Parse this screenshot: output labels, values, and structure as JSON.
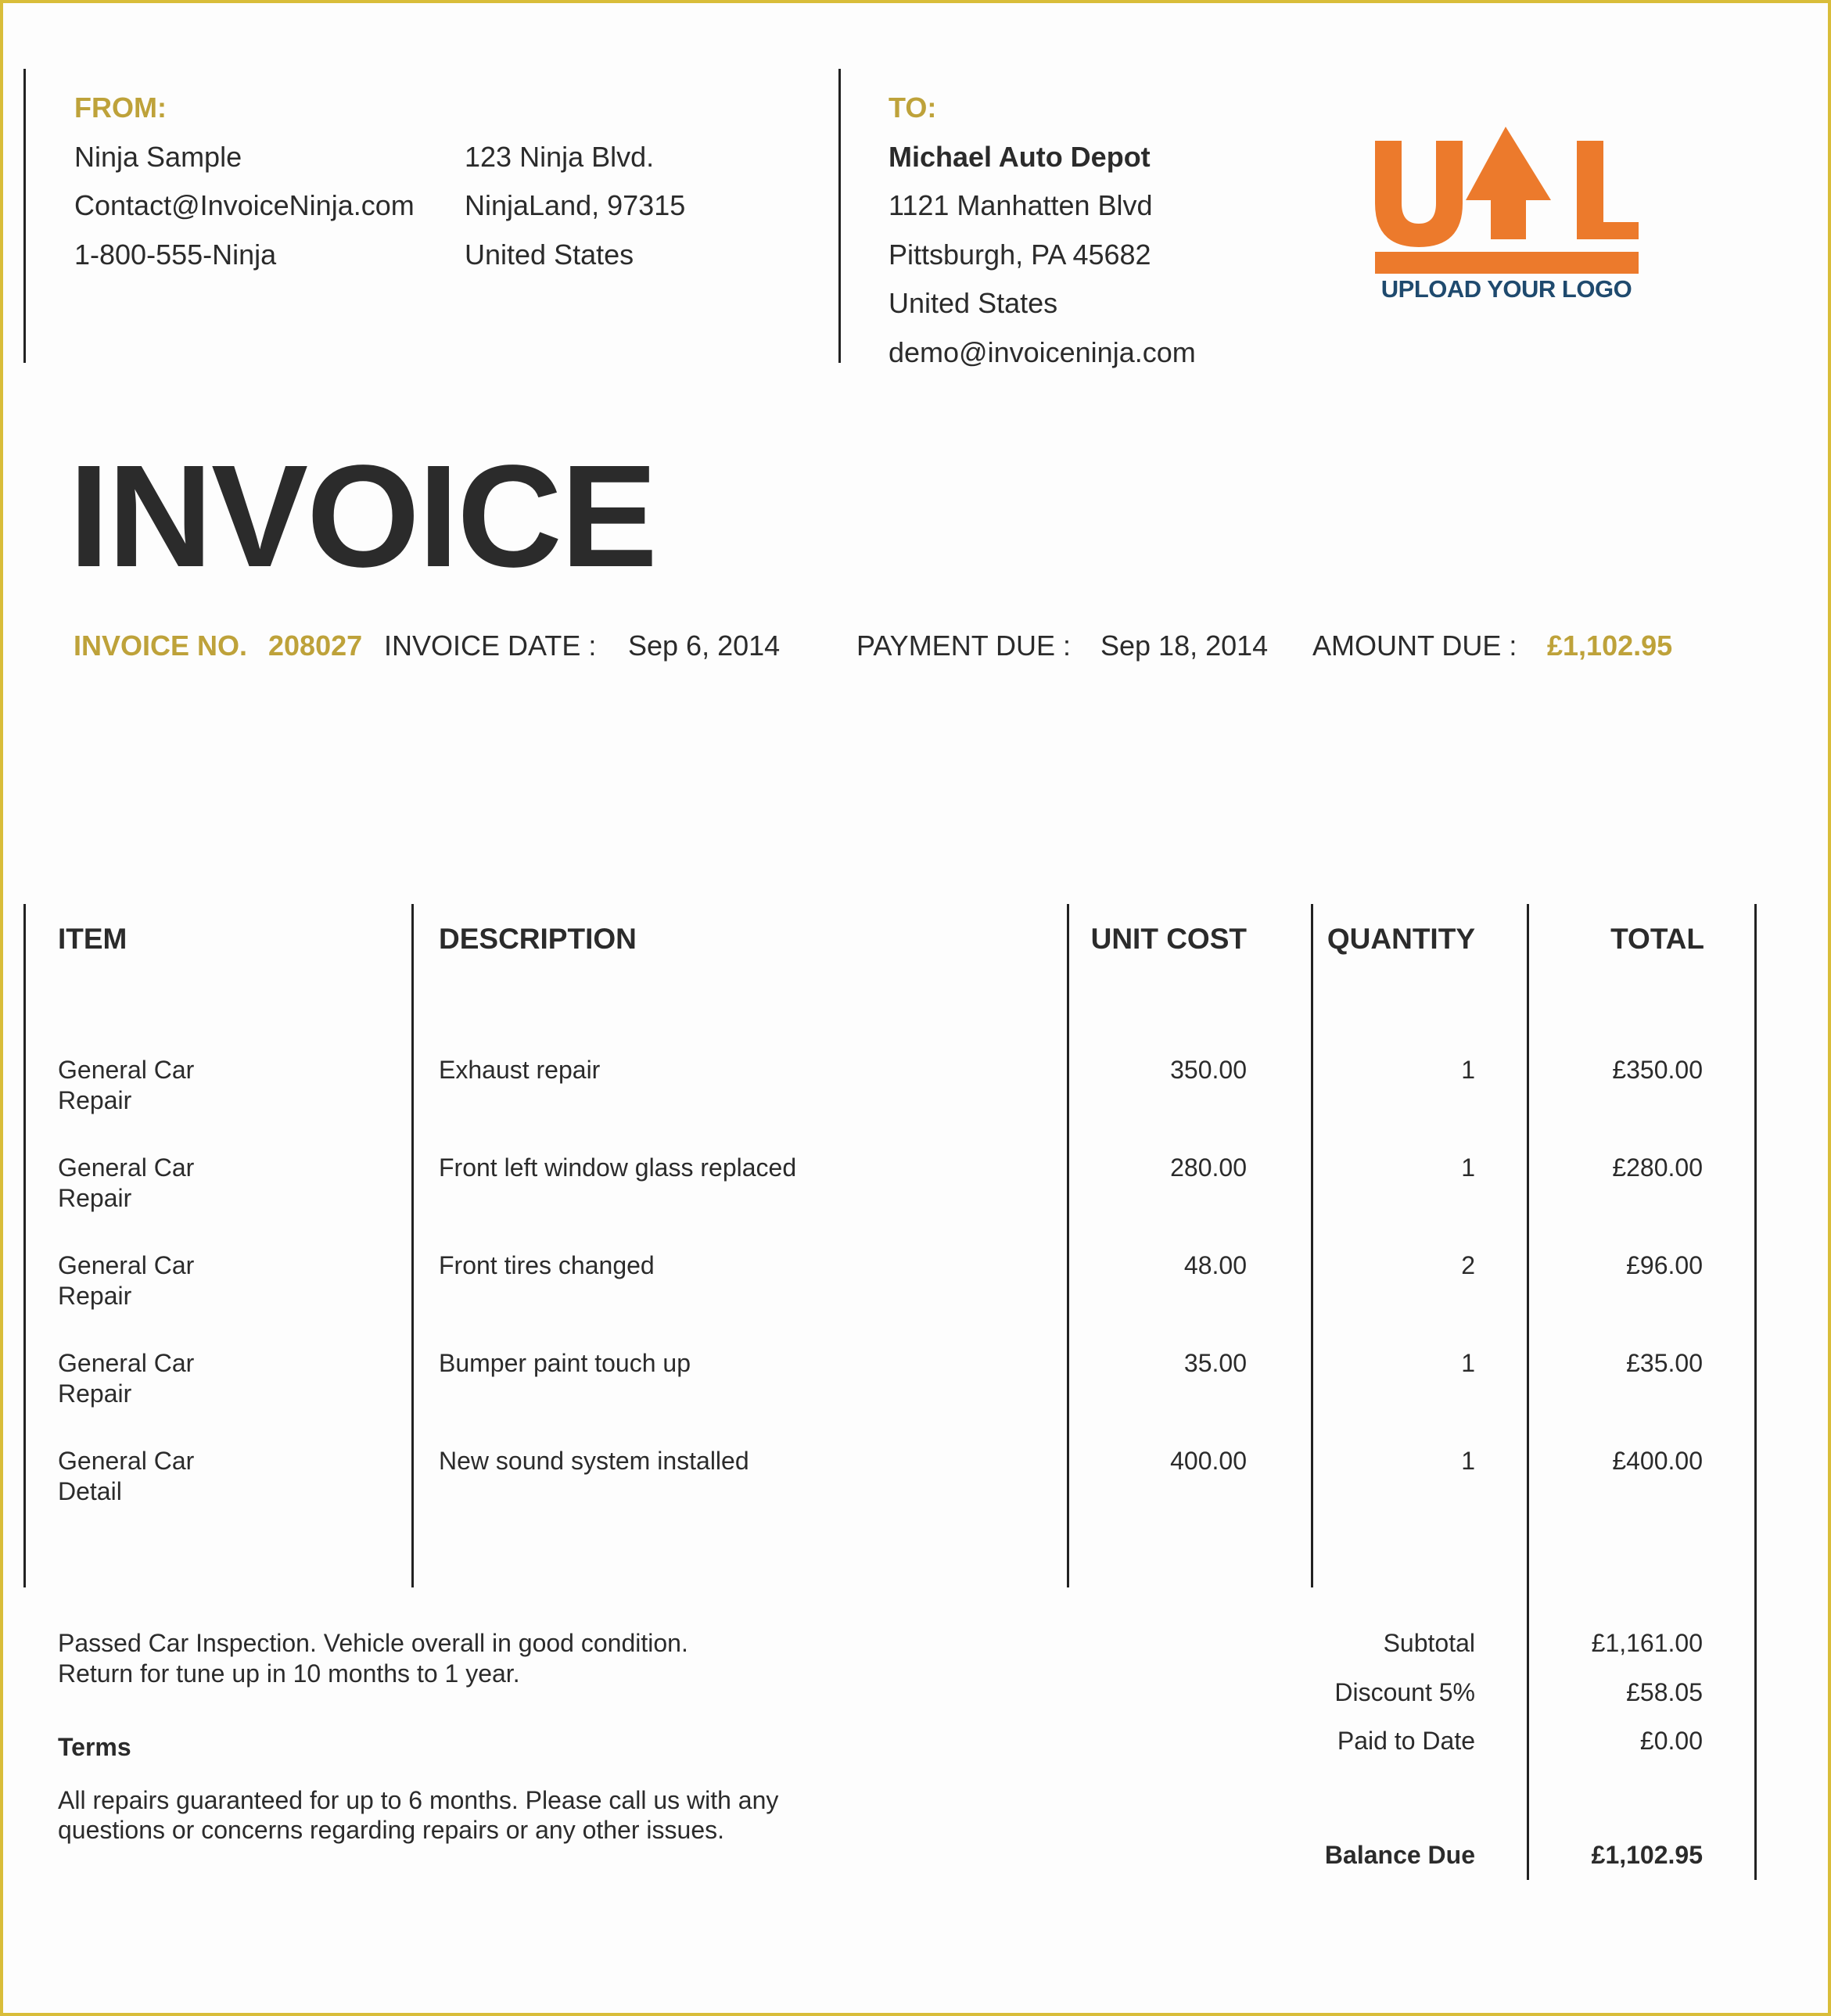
{
  "colors": {
    "accent_gold": "#bea23a",
    "frame_yellow": "#d9bd3a",
    "logo_orange": "#ec7a2c",
    "logo_navy": "#1f4a6e",
    "text": "#2b2b2b"
  },
  "from": {
    "label": "FROM:",
    "col1": [
      "Ninja Sample",
      "Contact@InvoiceNinja.com",
      "1-800-555-Ninja"
    ],
    "col2": [
      "123 Ninja Blvd.",
      "NinjaLand, 97315",
      "United States"
    ]
  },
  "to": {
    "label": "TO:",
    "name": "Michael Auto Depot",
    "lines": [
      "1121 Manhatten Blvd",
      "Pittsburgh, PA 45682",
      "United States",
      "demo@invoiceninja.com"
    ]
  },
  "logo": {
    "icon": "upload-arrow-icon",
    "letters": [
      "U",
      "L"
    ],
    "caption": "UPLOAD YOUR LOGO"
  },
  "title": "INVOICE",
  "meta": {
    "invoice_no_label": "INVOICE NO.",
    "invoice_no": "208027",
    "invoice_date_label": "INVOICE DATE :",
    "invoice_date": "Sep 6, 2014",
    "payment_due_label": "PAYMENT DUE :",
    "payment_due": "Sep 18, 2014",
    "amount_due_label": "AMOUNT DUE :",
    "amount_due": "£1,102.95"
  },
  "table": {
    "headers": {
      "item": "ITEM",
      "description": "DESCRIPTION",
      "unit_cost": "UNIT COST",
      "quantity": "QUANTITY",
      "total": "TOTAL"
    },
    "rows": [
      {
        "item": [
          "General Car",
          "Repair"
        ],
        "description": "Exhaust repair",
        "unit_cost": "350.00",
        "quantity": "1",
        "total": "£350.00"
      },
      {
        "item": [
          "General Car",
          "Repair"
        ],
        "description": "Front left window glass replaced",
        "unit_cost": "280.00",
        "quantity": "1",
        "total": "£280.00"
      },
      {
        "item": [
          "General Car",
          "Repair"
        ],
        "description": "Front tires changed",
        "unit_cost": "48.00",
        "quantity": "2",
        "total": "£96.00"
      },
      {
        "item": [
          "General Car",
          "Repair"
        ],
        "description": "Bumper paint touch up",
        "unit_cost": "35.00",
        "quantity": "1",
        "total": "£35.00"
      },
      {
        "item": [
          "General Car",
          "Detail"
        ],
        "description": "New sound system installed",
        "unit_cost": "400.00",
        "quantity": "1",
        "total": "£400.00"
      }
    ]
  },
  "notes": [
    "Passed Car Inspection. Vehicle overall in good condition.",
    "Return for tune up in 10 months to 1 year."
  ],
  "terms": {
    "label": "Terms",
    "lines": [
      "All repairs guaranteed for up to 6 months. Please call us with any",
      "questions or concerns regarding repairs or any other issues."
    ]
  },
  "totals": {
    "subtotal_label": "Subtotal",
    "subtotal": "£1,161.00",
    "discount_label": "Discount 5%",
    "discount": "£58.05",
    "paid_label": "Paid to Date",
    "paid": "£0.00",
    "balance_label": "Balance Due",
    "balance": "£1,102.95"
  }
}
